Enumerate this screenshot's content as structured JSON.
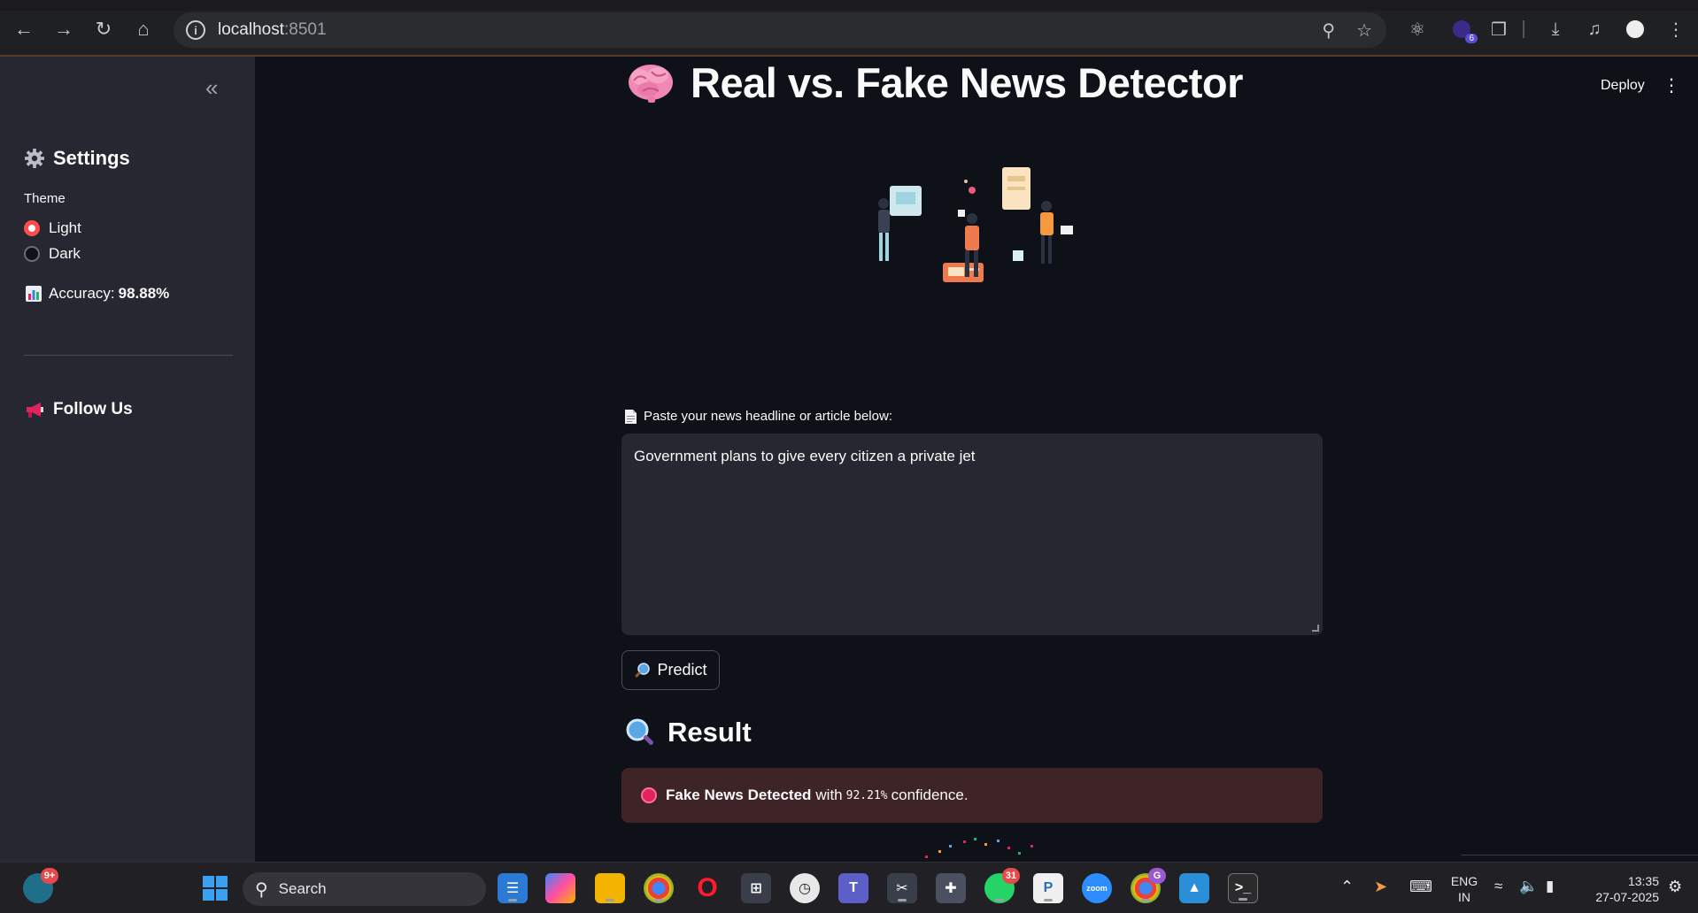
{
  "browser": {
    "url_host": "localhost",
    "url_port": ":8501",
    "extension_badge": "6"
  },
  "sidebar": {
    "settings_icon": "gear-icon",
    "settings_title": "Settings",
    "theme_label": "Theme",
    "theme_options": [
      {
        "label": "Light",
        "selected": true
      },
      {
        "label": "Dark",
        "selected": false
      }
    ],
    "accuracy_icon": "bar-chart-icon",
    "accuracy_label": "Accuracy:",
    "accuracy_value": "98.88%",
    "follow_icon": "megaphone-icon",
    "follow_title": "Follow Us"
  },
  "header": {
    "deploy_label": "Deploy"
  },
  "main": {
    "title_icon": "brain-icon",
    "title": "Real vs. Fake News Detector",
    "input_icon": "page-icon",
    "input_label": "Paste your news headline or article below:",
    "input_value": "Government plans to give every citizen a private jet",
    "predict_icon": "magnifier-icon",
    "predict_label": "Predict",
    "result_icon": "magnifier-icon",
    "result_title": "Result",
    "alert_icon": "red-circle-icon",
    "alert_bold": "Fake News Detected",
    "alert_with": "with",
    "alert_confidence": "92.21%",
    "alert_suffix": "confidence.",
    "alert_color": "#3e2327"
  },
  "taskbar": {
    "weather_badge": "9+",
    "search_placeholder": "Search",
    "whatsapp_badge": "31",
    "chrome_profile_badge": "G",
    "language_line1": "ENG",
    "language_line2": "IN",
    "time": "13:35",
    "date": "27-07-2025"
  }
}
